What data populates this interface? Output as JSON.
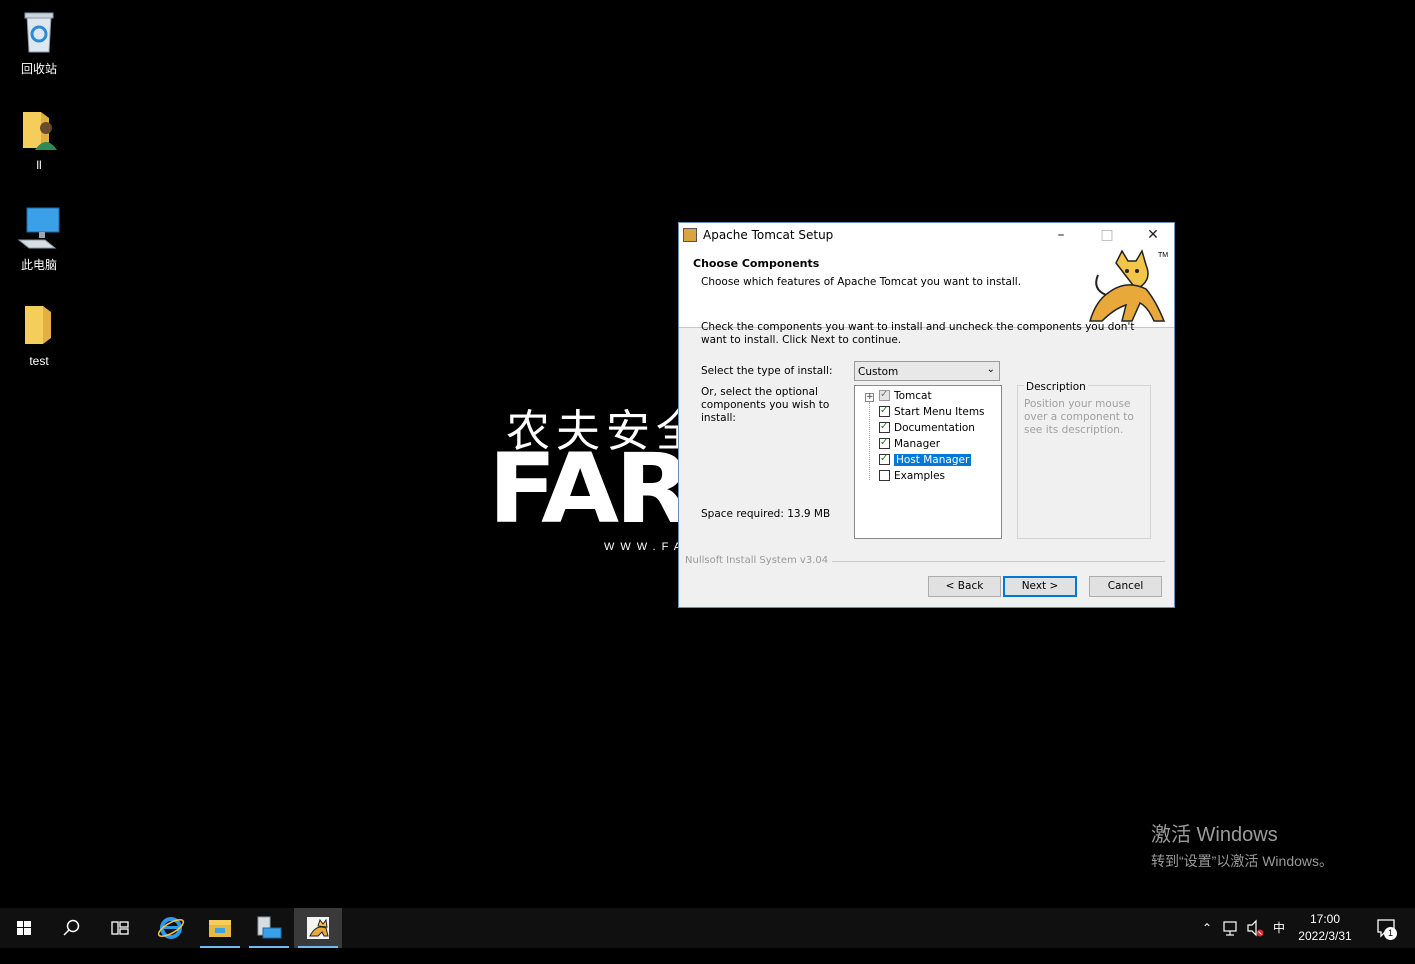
{
  "desktop": {
    "icons": [
      {
        "label": "回收站"
      },
      {
        "label": "ll"
      },
      {
        "label": "此电脑"
      },
      {
        "label": "test"
      }
    ],
    "wallpaper": {
      "cn_text": "农夫安全",
      "big_text": "FARM",
      "url_text": "WWW.FA"
    }
  },
  "window": {
    "title": "Apache Tomcat Setup",
    "header_title": "Choose Components",
    "header_subtitle": "Choose which features of Apache Tomcat you want to install.",
    "intro": "Check the components you want to install and uncheck the components you don't want to install. Click Next to continue.",
    "install_type_label": "Select the type of install:",
    "install_type_value": "Custom",
    "optional_label": "Or, select the optional components you wish to install:",
    "components": [
      {
        "label": "Tomcat",
        "checked": true,
        "disabled": true
      },
      {
        "label": "Start Menu Items",
        "checked": true
      },
      {
        "label": "Documentation",
        "checked": true
      },
      {
        "label": "Manager",
        "checked": true
      },
      {
        "label": "Host Manager",
        "checked": true,
        "selected": true
      },
      {
        "label": "Examples",
        "checked": false
      }
    ],
    "description_legend": "Description",
    "description_text": "Position your mouse over a component to see its description.",
    "space_required": "Space required: 13.9 MB",
    "branding": "Nullsoft Install System v3.04",
    "buttons": {
      "back": "< Back",
      "next": "Next >",
      "cancel": "Cancel"
    }
  },
  "activation": {
    "line1": "激活 Windows",
    "line2": "转到“设置”以激活 Windows。"
  },
  "taskbar": {
    "ime": "中",
    "time": "17:00",
    "date": "2022/3/31",
    "notification_count": "1"
  }
}
